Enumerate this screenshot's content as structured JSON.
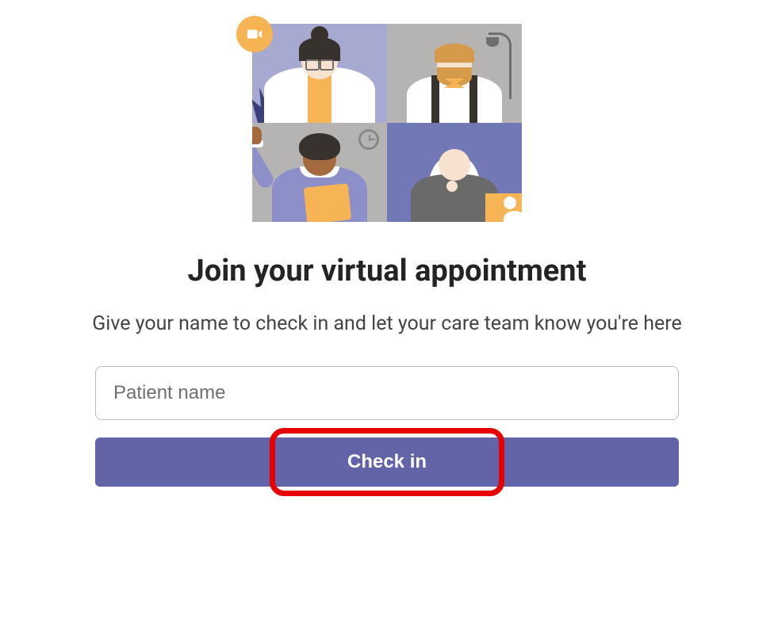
{
  "heading": "Join your virtual appointment",
  "subheading": "Give your name to check in and let your care team know you're here",
  "form": {
    "patient_name_placeholder": "Patient name",
    "patient_name_value": "",
    "checkin_label": "Check in"
  },
  "illustration": {
    "camera_badge_icon": "video-camera-icon",
    "participants": [
      "doctor-with-glasses",
      "bearded-person-bowtie",
      "waving-person-clipboard",
      "elder-person-white-hair"
    ],
    "pip_icon": "person-silhouette-icon"
  },
  "annotation": {
    "highlight_target": "check-in-button"
  },
  "colors": {
    "primary": "#6264a7",
    "accent": "#f6b455",
    "highlight": "#e60000"
  }
}
